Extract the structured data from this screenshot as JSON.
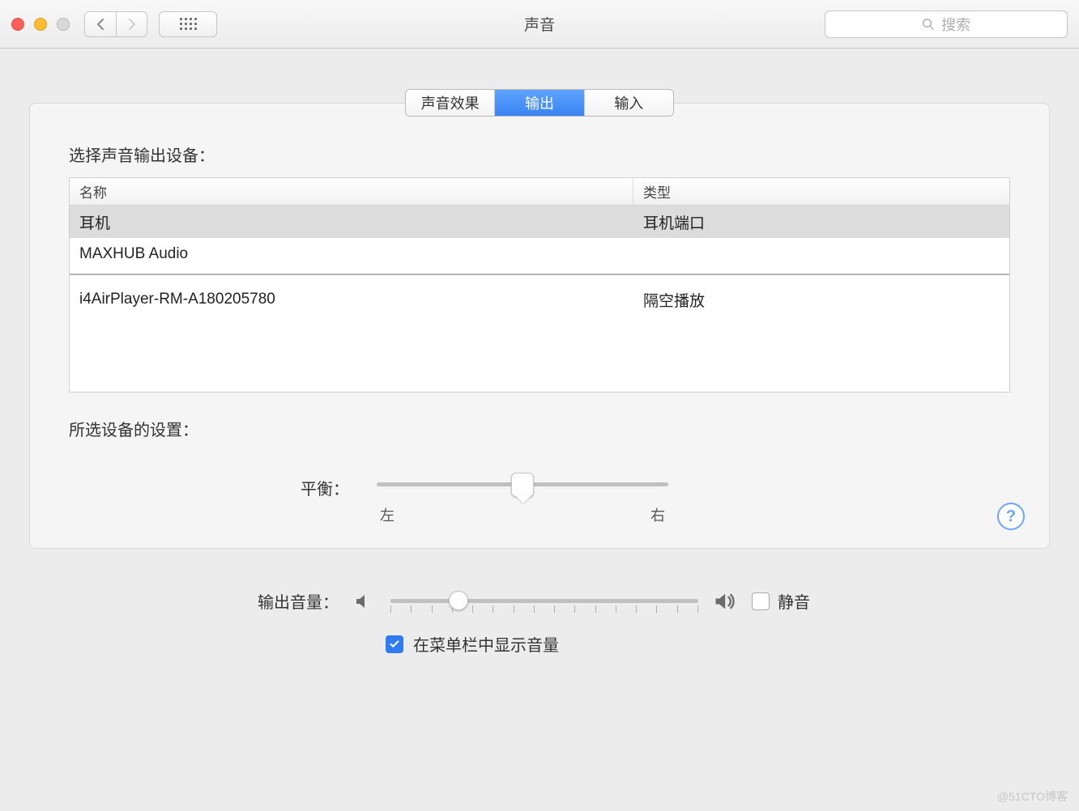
{
  "window": {
    "title": "声音"
  },
  "search": {
    "placeholder": "搜索"
  },
  "tabs": {
    "effects": "声音效果",
    "output": "输出",
    "input": "输入",
    "active": "output"
  },
  "output": {
    "select_label": "选择声音输出设备：",
    "columns": {
      "name": "名称",
      "type": "类型"
    },
    "devices": [
      {
        "name": "耳机",
        "type": "耳机端口",
        "selected": true
      },
      {
        "name": "MAXHUB Audio",
        "type": "",
        "selected": false
      },
      {
        "name": "i4AirPlayer-RM-A180205780",
        "type": "隔空播放",
        "selected": false,
        "separated": true
      }
    ],
    "settings_label": "所选设备的设置：",
    "balance": {
      "label": "平衡：",
      "left": "左",
      "right": "右",
      "value": 50
    }
  },
  "volume": {
    "label": "输出音量：",
    "value": 22,
    "mute_label": "静音",
    "mute_checked": false,
    "show_in_menubar_label": "在菜单栏中显示音量",
    "show_in_menubar_checked": true
  },
  "help": "?",
  "watermark": "@51CTO博客"
}
